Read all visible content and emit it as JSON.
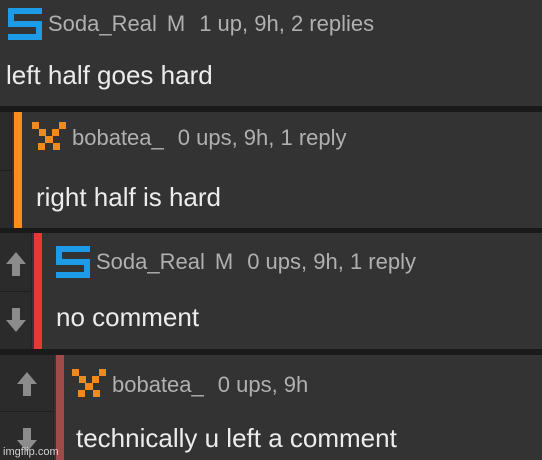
{
  "comments": [
    {
      "username": "Soda_Real",
      "badge": "M",
      "meta": "1 up, 9h, 2 replies",
      "text": "left half goes hard",
      "avatar_icon": "soda-real-avatar-icon",
      "avatar_color": "#1e9be6"
    },
    {
      "username": "bobatea_",
      "badge": "",
      "meta": "0 ups, 9h, 1 reply",
      "text": "right half is hard",
      "avatar_icon": "bobatea-avatar-icon",
      "avatar_color": "#f08a1c",
      "bar_color": "#ff8c1a"
    },
    {
      "username": "Soda_Real",
      "badge": "M",
      "meta": "0 ups, 9h, 1 reply",
      "text": "no comment",
      "avatar_icon": "soda-real-avatar-icon",
      "avatar_color": "#1e9be6",
      "bar_color": "#e53935"
    },
    {
      "username": "bobatea_",
      "badge": "",
      "meta": "0 ups, 9h",
      "text": "technically u left a comment",
      "avatar_icon": "bobatea-avatar-icon",
      "avatar_color": "#f08a1c",
      "bar_color": "#a04a4a"
    }
  ],
  "watermark": "imgflip.com"
}
